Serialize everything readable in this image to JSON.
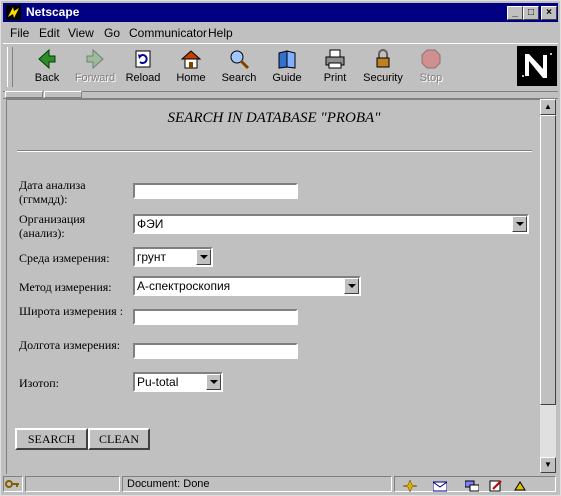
{
  "window": {
    "title": "Netscape"
  },
  "menu": {
    "items": [
      "File",
      "Edit",
      "View",
      "Go",
      "Communicator",
      "Help"
    ]
  },
  "toolbar": {
    "buttons": [
      {
        "label": "Back",
        "enabled": true
      },
      {
        "label": "Forward",
        "enabled": false
      },
      {
        "label": "Reload",
        "enabled": true
      },
      {
        "label": "Home",
        "enabled": true
      },
      {
        "label": "Search",
        "enabled": true
      },
      {
        "label": "Guide",
        "enabled": true
      },
      {
        "label": "Print",
        "enabled": true
      },
      {
        "label": "Security",
        "enabled": true
      },
      {
        "label": "Stop",
        "enabled": false
      }
    ]
  },
  "page": {
    "heading": "SEARCH IN DATABASE \"PROBA\"",
    "fields": {
      "date_label": "Дата анализа (ггммдд):",
      "date_value": "",
      "org_label": "Организация (анализ):",
      "org_value": "ФЭИ",
      "medium_label": "Среда измерения:",
      "medium_value": "грунт",
      "method_label": "Метод измерения:",
      "method_value": "А-спектроскопия",
      "lat_label": "Широта измерения :",
      "lat_value": "",
      "lon_label": "Долгота измерения:",
      "lon_value": "",
      "isotope_label": "Изотоп:",
      "isotope_value": "Pu-total"
    },
    "buttons": {
      "search": "SEARCH",
      "clean": "CLEAN"
    }
  },
  "statusbar": {
    "text": "Document: Done"
  },
  "colors": {
    "titlebar": "#000080",
    "chrome": "#c0c0c0"
  }
}
